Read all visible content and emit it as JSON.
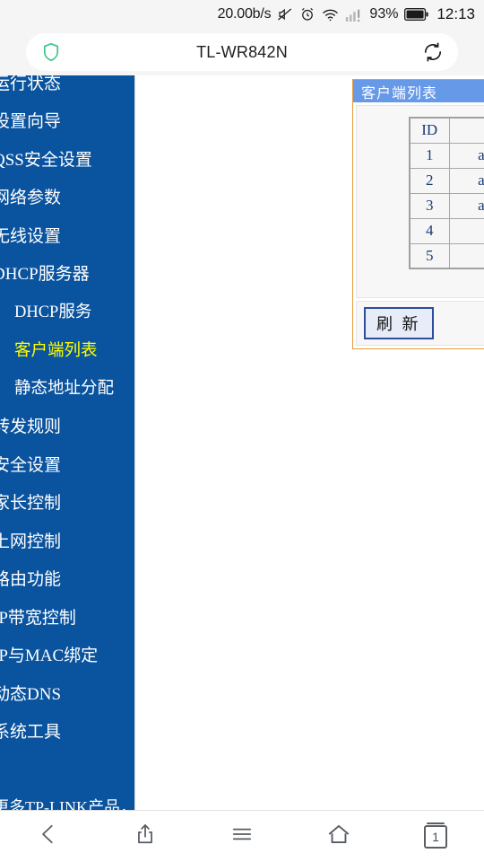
{
  "status_bar": {
    "network_speed": "20.00b/s",
    "mute_icon": "mute-icon",
    "alarm_icon": "alarm-clock-icon",
    "wifi_icon": "wifi-icon",
    "signal_icon": "cellular-signal-warning-icon",
    "battery_percent": "93%",
    "battery_icon": "battery-full-icon",
    "time": "12:13"
  },
  "browser": {
    "shield_icon": "shield-icon",
    "page_title": "TL-WR842N",
    "reload_icon": "reload-icon"
  },
  "sidebar": {
    "bg_color": "#0a539e",
    "active_color": "#ffff00",
    "items": [
      {
        "label": "运行状态",
        "level": 1,
        "active": false
      },
      {
        "label": "设置向导",
        "level": 1,
        "active": false
      },
      {
        "label": "QSS安全设置",
        "level": 1,
        "active": false
      },
      {
        "label": "网络参数",
        "level": 1,
        "active": false
      },
      {
        "label": "无线设置",
        "level": 1,
        "active": false
      },
      {
        "label": "DHCP服务器",
        "level": 1,
        "active": false
      },
      {
        "label": "DHCP服务",
        "level": 2,
        "active": false
      },
      {
        "label": "客户端列表",
        "level": 2,
        "active": true
      },
      {
        "label": "静态地址分配",
        "level": 2,
        "active": false
      },
      {
        "label": "转发规则",
        "level": 1,
        "active": false
      },
      {
        "label": "安全设置",
        "level": 1,
        "active": false
      },
      {
        "label": "家长控制",
        "level": 1,
        "active": false
      },
      {
        "label": "上网控制",
        "level": 1,
        "active": false
      },
      {
        "label": "路由功能",
        "level": 1,
        "active": false
      },
      {
        "label": "IP带宽控制",
        "level": 1,
        "active": false
      },
      {
        "label": "IP与MAC绑定",
        "level": 1,
        "active": false
      },
      {
        "label": "动态DNS",
        "level": 1,
        "active": false
      },
      {
        "label": "系统工具",
        "level": 1,
        "active": false
      }
    ],
    "footer_text": "更多TP-LINK产品，"
  },
  "client_list_panel": {
    "title": "客户端列表",
    "border_color": "#e89c3c",
    "header_color": "#6699e8",
    "columns": [
      "ID",
      ""
    ],
    "rows": [
      {
        "id": "1",
        "name": "andr"
      },
      {
        "id": "2",
        "name": "andr"
      },
      {
        "id": "3",
        "name": "andr"
      },
      {
        "id": "4",
        "name": ""
      },
      {
        "id": "5",
        "name": ""
      }
    ],
    "refresh_label": "刷 新"
  },
  "bottom_nav": {
    "back_icon": "back-chevron-icon",
    "share_icon": "share-icon",
    "menu_icon": "hamburger-menu-icon",
    "home_icon": "home-icon",
    "tabs_icon": "tabs-icon",
    "tab_count": "1"
  }
}
